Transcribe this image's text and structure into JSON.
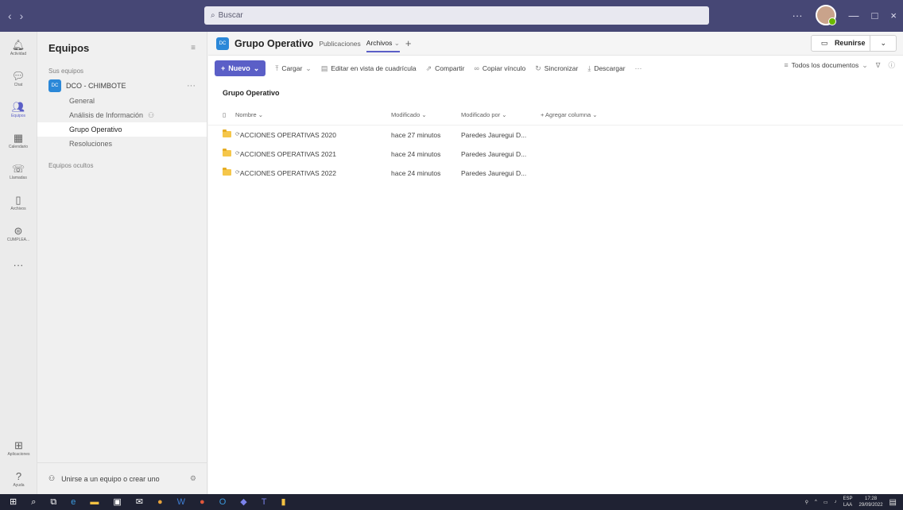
{
  "titlebar": {
    "search_placeholder": "Buscar",
    "more": "···",
    "minimize": "—",
    "maximize": "□",
    "close": "×"
  },
  "rail": [
    {
      "label": "Actividad",
      "icon": "bell-icon"
    },
    {
      "label": "Chat",
      "icon": "chat-icon"
    },
    {
      "label": "Equipos",
      "icon": "teams-icon",
      "active": true
    },
    {
      "label": "Calendario",
      "icon": "calendar-icon"
    },
    {
      "label": "Llamadas",
      "icon": "phone-icon"
    },
    {
      "label": "Archivos",
      "icon": "file-icon"
    },
    {
      "label": "CUMPLEA...",
      "icon": "app-icon"
    }
  ],
  "rail_more": "···",
  "rail_bottom": [
    {
      "label": "Aplicaciones",
      "icon": "apps-icon"
    },
    {
      "label": "Ayuda",
      "icon": "help-icon"
    }
  ],
  "teams_panel": {
    "title": "Equipos",
    "section_label": "Sus equipos",
    "team": {
      "badge": "DC",
      "name": "DCO - CHIMBOTE",
      "more": "···"
    },
    "channels": [
      {
        "label": "General"
      },
      {
        "label": "Análisis de Información"
      },
      {
        "label": "Grupo Operativo",
        "selected": true
      },
      {
        "label": "Resoluciones"
      }
    ],
    "hidden_label": "Equipos ocultos",
    "join_label": "Unirse a un equipo o crear uno"
  },
  "channel_header": {
    "badge": "DC",
    "title": "Grupo Operativo",
    "tabs": [
      {
        "label": "Publicaciones"
      },
      {
        "label": "Archivos",
        "active": true
      }
    ],
    "add_tab": "+",
    "meet_label": "Reunirse"
  },
  "commands": {
    "new": "Nuevo",
    "upload": "Cargar",
    "grid": "Editar en vista de cuadrícula",
    "share": "Compartir",
    "copy_link": "Copiar vínculo",
    "sync": "Sincronizar",
    "download": "Descargar",
    "more": "···",
    "view": "Todos los documentos"
  },
  "library": {
    "title": "Grupo Operativo",
    "columns": {
      "name": "Nombre",
      "modified": "Modificado",
      "modified_by": "Modificado por",
      "add_column": "+ Agregar columna"
    },
    "rows": [
      {
        "name": "ACCIONES OPERATIVAS 2020",
        "modified": "hace 27 minutos",
        "modified_by": "Paredes Jauregui D..."
      },
      {
        "name": "ACCIONES OPERATIVAS 2021",
        "modified": "hace 24 minutos",
        "modified_by": "Paredes Jauregui D..."
      },
      {
        "name": "ACCIONES OPERATIVAS 2022",
        "modified": "hace 24 minutos",
        "modified_by": "Paredes Jauregui D..."
      }
    ]
  },
  "taskbar": {
    "lang": "ESP",
    "layout": "LAA",
    "time": "17:28",
    "date": "29/09/2022"
  },
  "colors": {
    "titlebar": "#464775",
    "accent": "#5b5fc7",
    "folder": "#f5c64a",
    "taskbar": "#1f2233"
  }
}
